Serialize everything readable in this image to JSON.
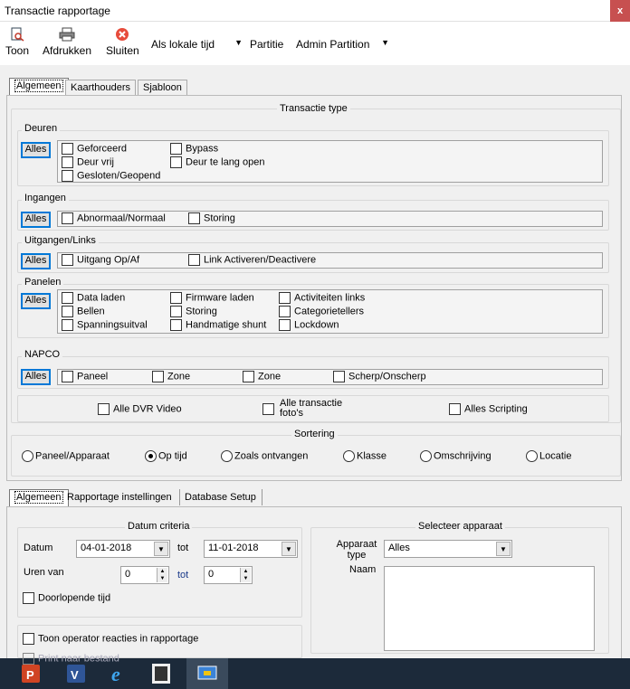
{
  "window": {
    "title": "Transactie rapportage",
    "close": "x"
  },
  "toolbar": {
    "toon": "Toon",
    "afdrukken": "Afdrukken",
    "sluiten": "Sluiten",
    "time_mode": "Als lokale tijd",
    "partitie_label": "Partitie",
    "partitie_value": "Admin Partition"
  },
  "top_tabs": [
    "Algemeen",
    "Kaarthouders",
    "Sjabloon"
  ],
  "transactie": {
    "title": "Transactie type",
    "alles": "Alles",
    "deuren": {
      "label": "Deuren",
      "items": [
        "Geforceerd",
        "Bypass",
        "Deur vrij",
        "Deur te lang open",
        "Gesloten/Geopend"
      ]
    },
    "ingangen": {
      "label": "Ingangen",
      "items": [
        "Abnormaal/Normaal",
        "Storing"
      ]
    },
    "uitgangen": {
      "label": "Uitgangen/Links",
      "items": [
        "Uitgang Op/Af",
        "Link Activeren/Deactivere"
      ]
    },
    "panelen": {
      "label": "Panelen",
      "items": [
        "Data laden",
        "Firmware laden",
        "Activiteiten links",
        "Bellen",
        "Storing",
        "Categorietellers",
        "Spanningsuitval",
        "Handmatige shunt",
        "Lockdown"
      ]
    },
    "napco": {
      "label": "NAPCO",
      "items": [
        "Paneel",
        "Zone",
        "Zone",
        "Scherp/Onscherp"
      ]
    },
    "extra": [
      "Alle DVR Video",
      "Alle transactie foto's",
      "Alles Scripting"
    ]
  },
  "sortering": {
    "title": "Sortering",
    "options": [
      "Paneel/Apparaat",
      "Op tijd",
      "Zoals ontvangen",
      "Klasse",
      "Omschrijving",
      "Locatie"
    ],
    "selected": "Op tijd"
  },
  "bottom_tabs": [
    "Algemeen",
    "Rapportage instellingen",
    "Database Setup"
  ],
  "datum": {
    "title": "Datum criteria",
    "datum_label": "Datum",
    "date_from": "04-01-2018",
    "tot": "tot",
    "date_to": "11-01-2018",
    "uren_label": "Uren van",
    "uren_from": "0",
    "uren_to": "0",
    "doorlopende": "Doorlopende tijd"
  },
  "apparaat": {
    "title": "Selecteer apparaat",
    "type_label": "Apparaat type",
    "type_value": "Alles",
    "naam_label": "Naam"
  },
  "options": {
    "operator": "Toon operator reacties in rapportage",
    "print": "Print naar bestand"
  },
  "colors": {
    "accent": "#0078d7",
    "close": "#c75050",
    "taskbar": "#1c2a3a"
  },
  "taskbar_icons": [
    "powerpoint-icon",
    "visio-icon",
    "internet-explorer-icon",
    "app-icon",
    "screen-app-icon"
  ]
}
